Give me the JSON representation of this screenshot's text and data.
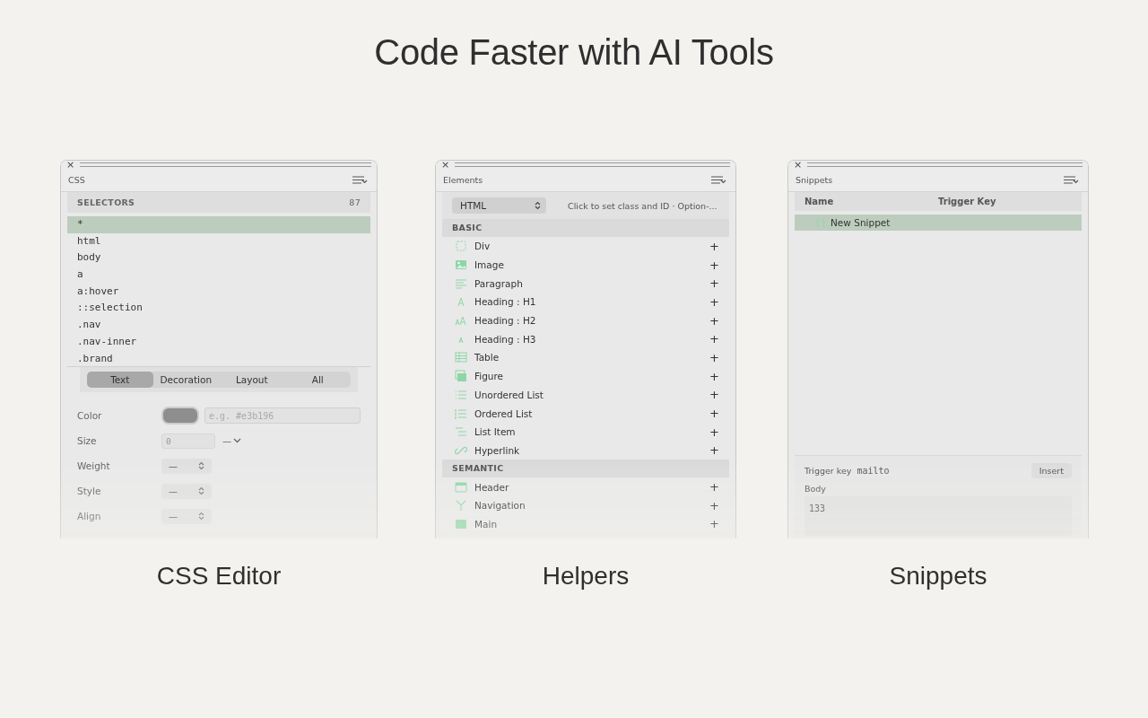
{
  "heading": "Code Faster with AI Tools",
  "panels": [
    {
      "kind": "css",
      "caption": "CSS Editor",
      "close": "×",
      "title": "CSS",
      "list_header": "SELECTORS",
      "count": "87",
      "selectors": [
        {
          "text": "*",
          "selected": true
        },
        {
          "text": "html",
          "selected": false
        },
        {
          "text": "body",
          "selected": false
        },
        {
          "text": "a",
          "selected": false
        },
        {
          "text": "a:hover",
          "selected": false
        },
        {
          "text": "::selection",
          "selected": false
        },
        {
          "text": ".nav",
          "selected": false
        },
        {
          "text": ".nav-inner",
          "selected": false
        },
        {
          "text": ".brand",
          "selected": false
        }
      ],
      "tabs": [
        {
          "label": "Text",
          "selected": true
        },
        {
          "label": "Decoration",
          "selected": false
        },
        {
          "label": "Layout",
          "selected": false
        },
        {
          "label": "All",
          "selected": false
        }
      ],
      "properties": [
        {
          "label": "Color",
          "kind": "color",
          "placeholder": "e.g. #e3b196"
        },
        {
          "label": "Size",
          "kind": "number",
          "value": "0",
          "unit": "—"
        },
        {
          "label": "Weight",
          "kind": "select",
          "value": "—"
        },
        {
          "label": "Style",
          "kind": "select",
          "value": "—"
        },
        {
          "label": "Align",
          "kind": "select",
          "value": "—"
        }
      ]
    },
    {
      "kind": "elements",
      "caption": "Helpers",
      "close": "×",
      "title": "Elements",
      "dropdown": "HTML",
      "hint": "Click to set class and ID · Option-...",
      "sections": [
        {
          "title": "BASIC",
          "items": [
            {
              "label": "Div",
              "add": "+"
            },
            {
              "label": "Image",
              "add": "+"
            },
            {
              "label": "Paragraph",
              "add": "+"
            },
            {
              "label": "Heading : H1",
              "add": "+"
            },
            {
              "label": "Heading : H2",
              "add": "+"
            },
            {
              "label": "Heading : H3",
              "add": "+"
            },
            {
              "label": "Table",
              "add": "+"
            },
            {
              "label": "Figure",
              "add": "+"
            },
            {
              "label": "Unordered List",
              "add": "+"
            },
            {
              "label": "Ordered List",
              "add": "+"
            },
            {
              "label": "List Item",
              "add": "+"
            },
            {
              "label": "Hyperlink",
              "add": "+"
            }
          ]
        },
        {
          "title": "SEMANTIC",
          "items": [
            {
              "label": "Header",
              "add": "+"
            },
            {
              "label": "Navigation",
              "add": "+"
            },
            {
              "label": "Main",
              "add": "+"
            }
          ]
        }
      ]
    },
    {
      "kind": "snippets",
      "caption": "Snippets",
      "close": "×",
      "title": "Snippets",
      "columns": [
        "Name",
        "Trigger Key"
      ],
      "rows": [
        {
          "name": "New Snippet",
          "selected": true
        }
      ],
      "trigger_label": "Trigger key",
      "trigger_value": "mailto",
      "insert": "Insert",
      "body_label": "Body",
      "body_value": "133"
    }
  ]
}
